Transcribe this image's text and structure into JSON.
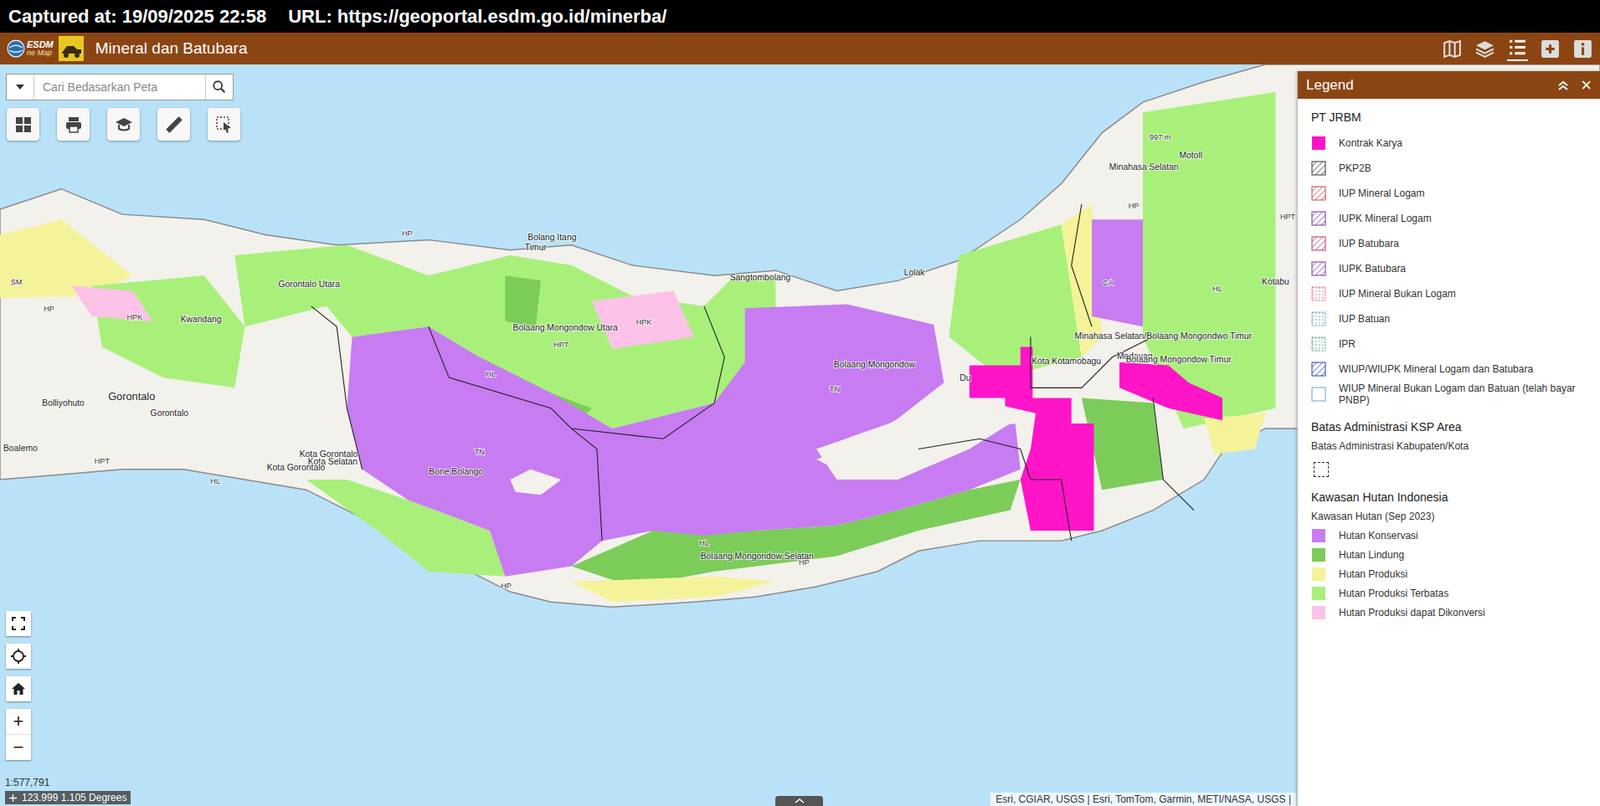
{
  "capture_bar": {
    "captured": "Captured at: 19/09/2025 22:58",
    "url": "URL: https://geoportal.esdm.go.id/minerba/"
  },
  "header": {
    "logo": "ESDM",
    "logo_sub": "ne Map",
    "title": "Mineral dan Batubara"
  },
  "search": {
    "placeholder": "Cari Bedasarkan Peta"
  },
  "zoom": {
    "in": "+",
    "out": "−"
  },
  "legend": {
    "title": "Legend",
    "close": "×",
    "groups": [
      {
        "title": "PT JRBM",
        "subtitle": "",
        "items": [
          {
            "label": "Kontrak Karya",
            "kind": "fill",
            "color": "#ff14c8"
          },
          {
            "label": "PKP2B",
            "kind": "hatch",
            "color": "#333333"
          },
          {
            "label": "IUP Mineral Logam",
            "kind": "hatch",
            "color": "#d04050"
          },
          {
            "label": "IUPK Mineral Logam",
            "kind": "hatch",
            "color": "#7030a0"
          },
          {
            "label": "IUP Batubara",
            "kind": "hatch",
            "color": "#c03060"
          },
          {
            "label": "IUPK Batubara",
            "kind": "hatch",
            "color": "#8030b0"
          },
          {
            "label": "IUP Mineral Bukan Logam",
            "kind": "dots",
            "color": "#e05070"
          },
          {
            "label": "IUP Batuan",
            "kind": "dots",
            "color": "#5090d0"
          },
          {
            "label": "IPR",
            "kind": "dots",
            "color": "#30a070"
          },
          {
            "label": "WIUP/WIUPK Mineral Logam dan Batubara",
            "kind": "hatch",
            "color": "#2040c0"
          },
          {
            "label": "WIUP Mineral Bukan Logam dan Batuan (telah bayar PNBP)",
            "kind": "outline",
            "color": "#7fb2e0"
          }
        ]
      },
      {
        "title": "Batas Administrasi KSP Area",
        "subtitle": "",
        "items": [
          {
            "label": "Batas Administrasi Kabupaten/Kota",
            "kind": "boundary",
            "color": "#333333"
          }
        ]
      },
      {
        "title": "Kawasan Hutan Indonesia",
        "subtitle": "Kawasan Hutan (Sep 2023)",
        "items": [
          {
            "label": "Hutan Konservasi",
            "kind": "fill",
            "color": "#c77cf2"
          },
          {
            "label": "Hutan Lindung",
            "kind": "fill",
            "color": "#7ccc5a"
          },
          {
            "label": "Hutan Produksi",
            "kind": "fill",
            "color": "#f5f39a"
          },
          {
            "label": "Hutan Produksi Terbatas",
            "kind": "fill",
            "color": "#a8f07a"
          },
          {
            "label": "Hutan Produksi dapat Dikonversi",
            "kind": "fill",
            "color": "#fcc2e8"
          }
        ]
      }
    ]
  },
  "map": {
    "scale": "1:577,791",
    "coordinates": "123.999 1.105 Degrees",
    "attribution": "Esri, CGIAR, USGS | Esri, TomTom, Garmin, METI/NASA, USGS |",
    "labels": [
      {
        "text": "Gorontalo Utara",
        "kind": "place"
      },
      {
        "text": "Bolang Itang",
        "kind": "place"
      },
      {
        "text": "Timur",
        "kind": "place"
      },
      {
        "text": "Sangtombolang",
        "kind": "place"
      },
      {
        "text": "Lolak",
        "kind": "place"
      },
      {
        "text": "Bolaang Mongondow Utara",
        "kind": "place"
      },
      {
        "text": "Bolaang Mongondow",
        "kind": "place"
      },
      {
        "text": "Kota Kotamobagu",
        "kind": "place"
      },
      {
        "text": "Kwandang",
        "kind": "place"
      },
      {
        "text": "Bolliyohuto",
        "kind": "place"
      },
      {
        "text": "Gorontalo",
        "kind": "city"
      },
      {
        "text": "Gorontalo",
        "kind": "place"
      },
      {
        "text": "Boalemo",
        "kind": "place"
      },
      {
        "text": "Kota Gorontalo",
        "kind": "place"
      },
      {
        "text": "Kota Selatan",
        "kind": "place"
      },
      {
        "text": "Kota Gorontalo",
        "kind": "place"
      },
      {
        "text": "Bone Bolango",
        "kind": "place"
      },
      {
        "text": "Bolaang Mongondow Selatan",
        "kind": "place"
      },
      {
        "text": "Minahasa Selatan",
        "kind": "place"
      },
      {
        "text": "Motoll",
        "kind": "place"
      },
      {
        "text": "Minahasa Selatan/Bolaang Mongondwo Timur",
        "kind": "place"
      },
      {
        "text": "Modayag",
        "kind": "place"
      },
      {
        "text": "Bolaang Mongondow Timur",
        "kind": "place"
      },
      {
        "text": "Kotabu",
        "kind": "place"
      },
      {
        "text": "Du",
        "kind": "place"
      },
      {
        "text": "997 m",
        "kind": "code"
      },
      {
        "text": "HP",
        "kind": "code"
      },
      {
        "text": "HP",
        "kind": "code"
      },
      {
        "text": "HP",
        "kind": "code"
      },
      {
        "text": "HP",
        "kind": "code"
      },
      {
        "text": "HP",
        "kind": "code"
      },
      {
        "text": "HPT",
        "kind": "code"
      },
      {
        "text": "HPT",
        "kind": "code"
      },
      {
        "text": "HPT",
        "kind": "code"
      },
      {
        "text": "HPK",
        "kind": "code"
      },
      {
        "text": "HPK",
        "kind": "code"
      },
      {
        "text": "HL",
        "kind": "code"
      },
      {
        "text": "HL",
        "kind": "code"
      },
      {
        "text": "HL",
        "kind": "code"
      },
      {
        "text": "HL",
        "kind": "code"
      },
      {
        "text": "TN",
        "kind": "code"
      },
      {
        "text": "TN",
        "kind": "code"
      },
      {
        "text": "CA",
        "kind": "code"
      },
      {
        "text": "SM",
        "kind": "code"
      }
    ]
  }
}
